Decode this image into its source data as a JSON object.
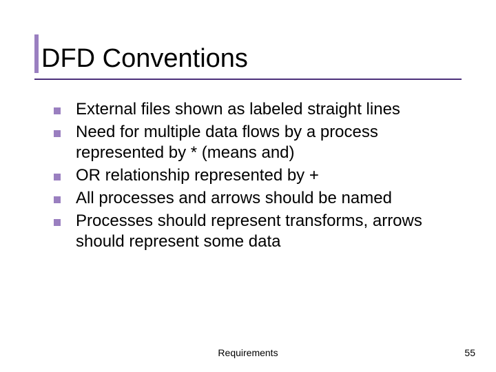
{
  "accent_color": "#9a7fc0",
  "rule_color": "#4b2f7a",
  "title": "DFD Conventions",
  "bullets": [
    "External files shown as labeled straight lines",
    "Need for multiple data flows by a process represented by * (means and)",
    "OR relationship represented by +",
    "All processes and arrows should be named",
    "Processes should represent transforms, arrows should represent some data"
  ],
  "footer": {
    "center": "Requirements",
    "page_number": "55"
  }
}
